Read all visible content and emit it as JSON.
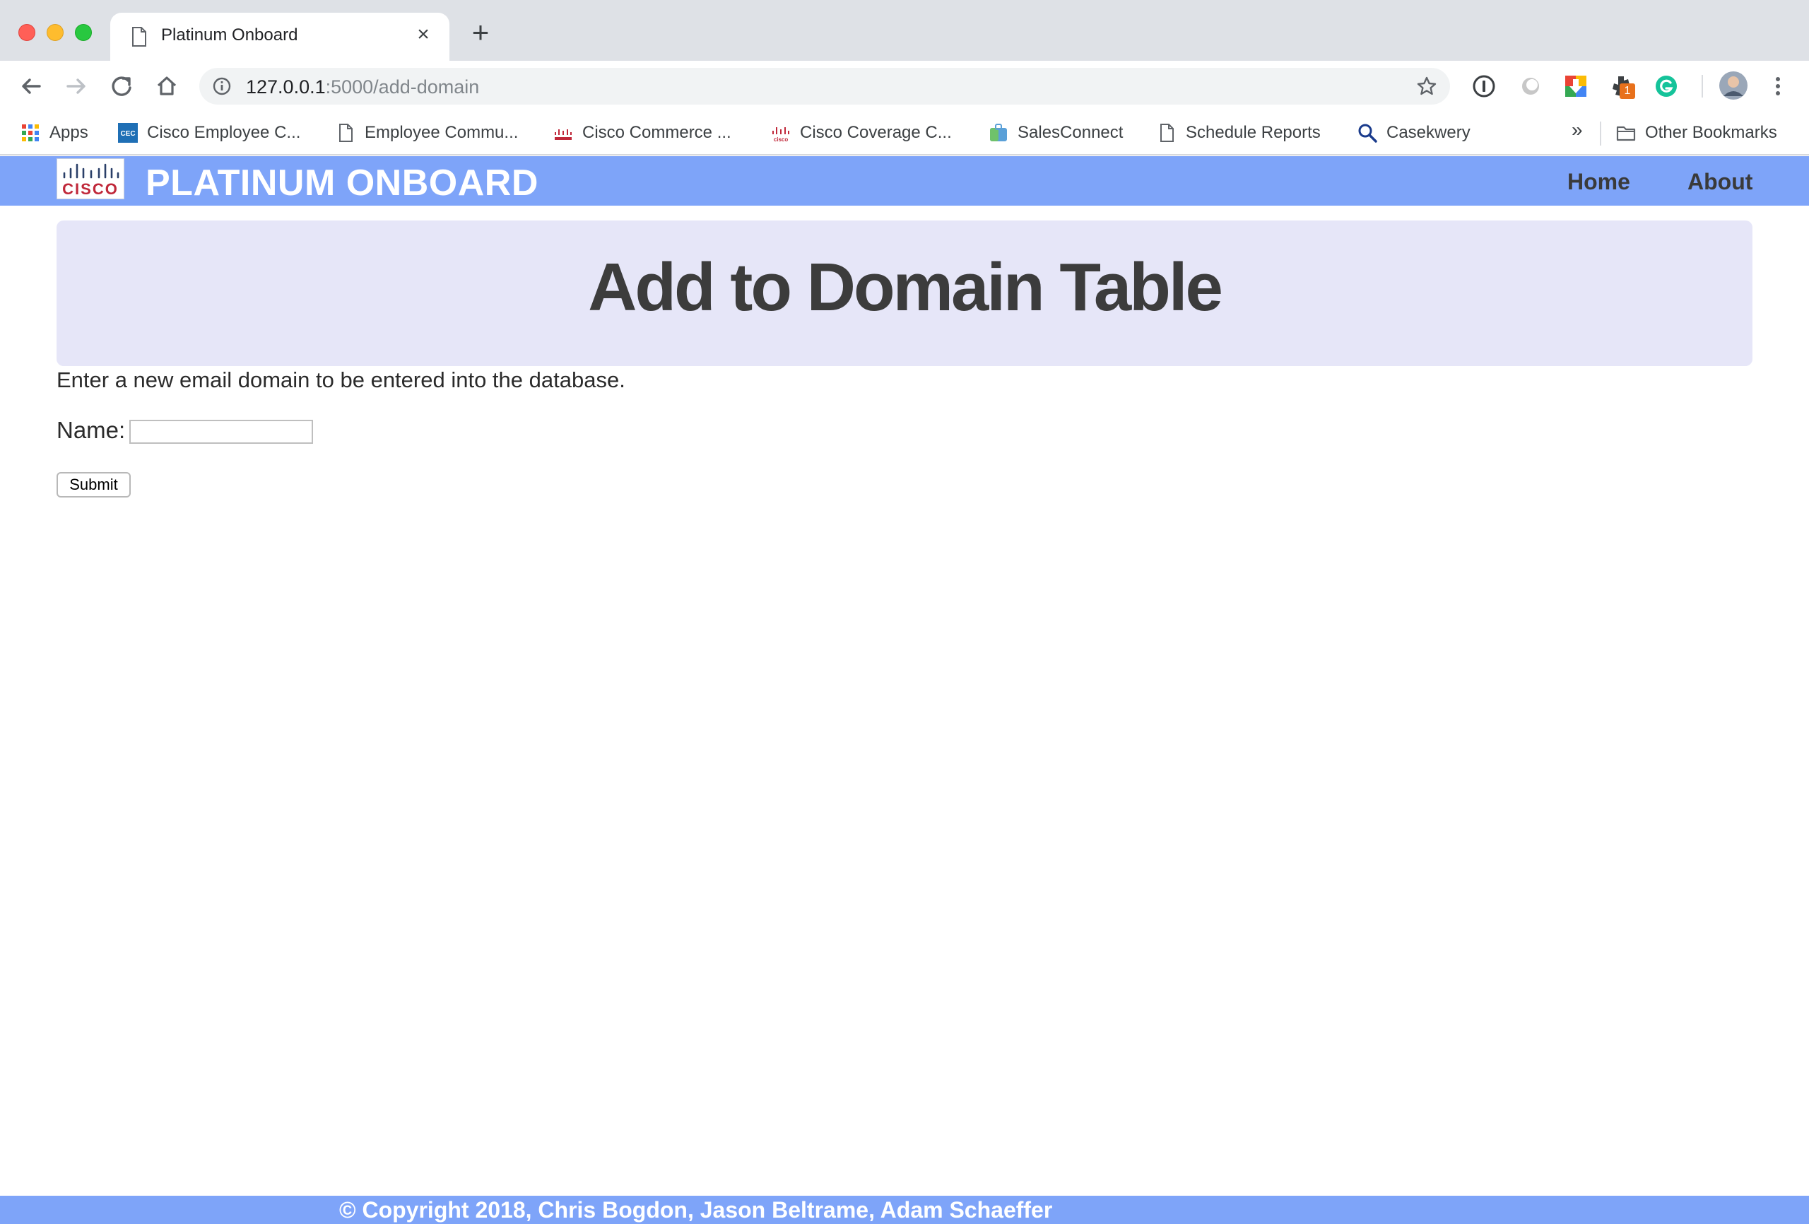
{
  "browser": {
    "tab_title": "Platinum Onboard",
    "tab_close_glyph": "×",
    "new_tab_glyph": "+",
    "url_host": "127.0.0.1",
    "url_path": ":5000/add-domain",
    "extensions": [
      "onepassword-icon",
      "extension-circle-icon",
      "download-extension-icon",
      "puzzle-extension-icon",
      "grammarly-icon"
    ],
    "extension_badge": "1"
  },
  "bookmarks": {
    "items": [
      {
        "label": "Apps",
        "icon": "apps-grid-icon"
      },
      {
        "label": "Cisco Employee C...",
        "icon": "cec-icon"
      },
      {
        "label": "Employee Commu...",
        "icon": "page-icon"
      },
      {
        "label": "Cisco Commerce ...",
        "icon": "cisco-icon"
      },
      {
        "label": "Cisco Coverage C...",
        "icon": "cisco-icon"
      },
      {
        "label": "SalesConnect",
        "icon": "salesconnect-icon"
      },
      {
        "label": "Schedule Reports",
        "icon": "page-icon"
      },
      {
        "label": "Casekwery",
        "icon": "search-icon"
      }
    ],
    "overflow_glyph": "»",
    "other": "Other Bookmarks"
  },
  "site": {
    "logo_text": "CISCO",
    "brand": "PLATINUM ONBOARD",
    "nav": {
      "home": "Home",
      "about": "About"
    },
    "accent_color": "#7ea4f9"
  },
  "main": {
    "heading": "Add to Domain Table",
    "intro": "Enter a new email domain to be entered into the database.",
    "form": {
      "name_label": "Name:",
      "name_value": "",
      "submit_label": "Submit"
    }
  },
  "footer": {
    "copyright": "© Copyright 2018, Chris Bogdon, Jason Beltrame, Adam Schaeffer"
  }
}
